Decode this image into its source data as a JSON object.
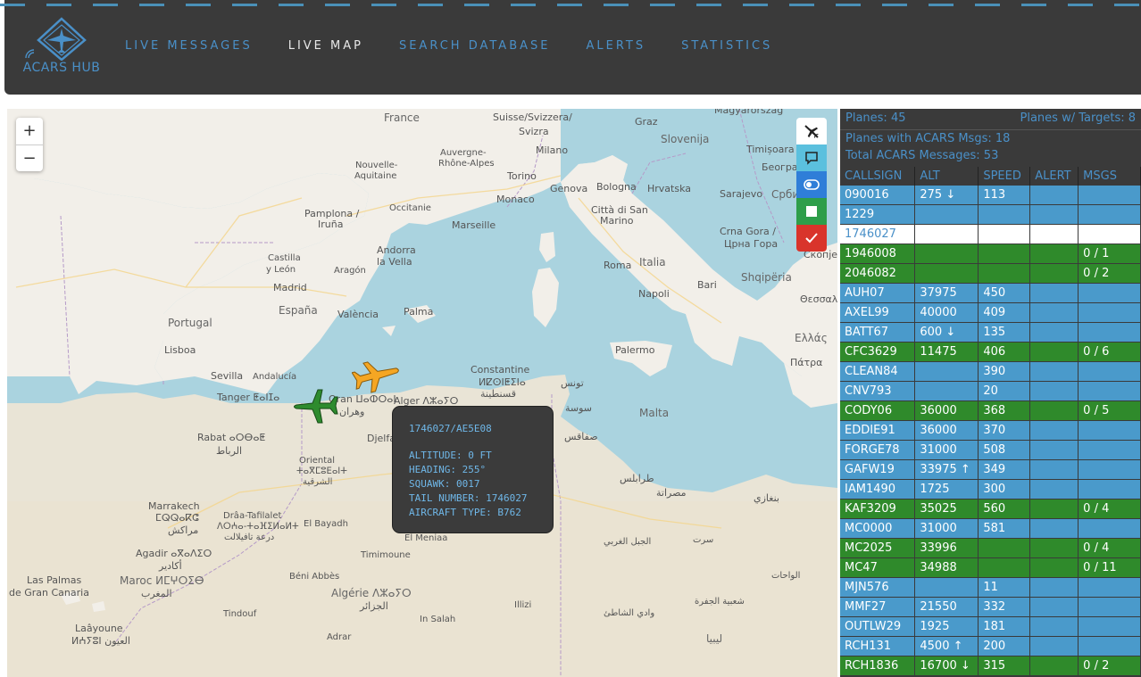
{
  "app": {
    "logo_text": "ACARS HUB",
    "nav": [
      {
        "label": "LIVE MESSAGES",
        "active": false
      },
      {
        "label": "LIVE MAP",
        "active": true
      },
      {
        "label": "SEARCH DATABASE",
        "active": false
      },
      {
        "label": "ALERTS",
        "active": false
      },
      {
        "label": "STATISTICS",
        "active": false
      }
    ]
  },
  "map": {
    "zoom_in": "+",
    "zoom_out": "−",
    "labels": {
      "france": "France",
      "suisse": "Suisse/Svizzera/",
      "svizra": "Svizra",
      "graz": "Graz",
      "magyarorszag": "Magyarország",
      "slovenija": "Slovenija",
      "timisoara": "Timișoara",
      "beograd": "Београд",
      "milano": "Milano",
      "auvergne": "Auvergne-",
      "rhone": "Rhône-Alpes",
      "torino": "Torino",
      "genova": "Genova",
      "bologna": "Bologna",
      "hrvatska": "Hrvatska",
      "sarajevo": "Sarajevo",
      "srbi": "Срби",
      "nouvelle": "Nouvelle-",
      "aquitaine": "Aquitaine",
      "occitanie": "Occitanie",
      "monaco": "Monaco",
      "citta1": "Città di San",
      "citta2": "Marino",
      "crnagora1": "Crna Gora /",
      "crnagora2": "Црна Гора",
      "skopje": "Скопје",
      "pamplona1": "Pamplona /",
      "pamplona2": "Iruña",
      "marseille": "Marseille",
      "andorra1": "Andorra",
      "andorra2": "la Vella",
      "roma": "Roma",
      "italia": "Italia",
      "bari": "Bari",
      "shqiperia": "Shqipëria",
      "castilla1": "Castilla",
      "castilla2": "y León",
      "aragon": "Aragón",
      "napoli": "Napoli",
      "thessaloniki": "Θεσσαλ",
      "madrid": "Madrid",
      "espana": "España",
      "valencia": "València",
      "palma": "Palma",
      "portugal": "Portugal",
      "ellas": "Ελλάς",
      "lisboa": "Lisboa",
      "patra": "Πάτρα",
      "palermo": "Palermo",
      "sevilla": "Sevilla",
      "andalucia": "Andalucía",
      "constantine1": "Constantine",
      "constantine2": "ⵍⵇⵙⵏⵟⵉⵏⴰ",
      "constantine3": "قسنطينة",
      "tunis": "تونس",
      "tanger": "Tanger ⵟⴰⵏⵊⴰ",
      "oran": "Oran ⵡⴰⵀⵔⴰⵏ",
      "wahran": "وهران",
      "alger": "Alger ⴷⵣⴰⵢⵔ",
      "sousse": "سوسة",
      "malta": "Malta",
      "rabat1": "Rabat ⴰⵔⴱⴰⵟ",
      "rabat2": "الرباط",
      "djelfa": "Djelfa",
      "sfax": "صفاقس",
      "oriental1": "Oriental",
      "oriental2": "ⵜⴰⴳⵎⵓⴹⴰⵏⵜ",
      "oriental3": "الشرقية",
      "tripoli": "طرابلس",
      "misrata": "مصراتة",
      "benghazi": "بنغازي",
      "marrakech1": "Marrakech",
      "marrakech2": "ⵎⵕⵕⴰⴽⵛ",
      "marrakech3": "مراكش",
      "draa1": "Drâa-Tafilalet",
      "draa2": "ⴷⵔⵄⴰ-ⵜⴰⴼⵉⵍⴰⵍⵜ",
      "draa3": "درعة تافيلالت",
      "elbayadh": "El Bayadh",
      "agadir1": "Agadir ⴰⴳⴰⴷⵉⵔ",
      "agadir2": "أكادير",
      "elmeniaa": "El Meniaa",
      "jabal": "الجبل الغربي",
      "sirte": "سرت",
      "lapalmas1": "Las Palmas",
      "lapalmas2": "de Gran Canaria",
      "maroc1": "Maroc ⵍⵎⵖⵔⵉⴱ",
      "maroc2": "المغرب",
      "timimoune": "Timimoune",
      "beniabbes": "Béni Abbès",
      "waha": "الواحات",
      "algerie1": "Algérie ⴷⵣⴰⵢⵔ",
      "algerie2": "الجزائر",
      "illizi": "Illizi",
      "shati": "وادي الشاطئ",
      "jufra": "شعبية الجفرة",
      "tindouf": "Tindouf",
      "insalah": "In Salah",
      "laayoune1": "Laâyoune",
      "laayoune2": "ⵍⵄⵢⵓⵏ العيون",
      "adrar": "Adrar",
      "libya": "ليبيا"
    },
    "tooltip": {
      "title": "1746027/AE5E08",
      "altitude": "ALTITUDE: 0 FT",
      "heading": "HEADING: 255°",
      "squawk": "SQUAWK: 0017",
      "tail": "TAIL NUMBER: 1746027",
      "type": "AIRCRAFT TYPE: B762"
    },
    "aircraft_colors": {
      "selected": "#f5a623",
      "acars": "#2e8b2e"
    }
  },
  "panel": {
    "planes": "Planes: 45",
    "planes_targets": "Planes w/ Targets: 8",
    "planes_acars": "Planes with ACARS Msgs: 18",
    "total_acars": "Total ACARS Messages: 53",
    "columns": [
      "CALLSIGN",
      "ALT",
      "SPEED",
      "ALERT",
      "MSGS"
    ],
    "rows": [
      {
        "c": "090016",
        "a": "275 ↓",
        "s": "113",
        "al": "",
        "m": "",
        "color": "blue"
      },
      {
        "c": "1229",
        "a": "",
        "s": "",
        "al": "",
        "m": "",
        "color": "blue"
      },
      {
        "c": "1746027",
        "a": "",
        "s": "",
        "al": "",
        "m": "",
        "color": "white"
      },
      {
        "c": "1946008",
        "a": "",
        "s": "",
        "al": "",
        "m": "0 / 1",
        "color": "green"
      },
      {
        "c": "2046082",
        "a": "",
        "s": "",
        "al": "",
        "m": "0 / 2",
        "color": "green"
      },
      {
        "c": "AUH07",
        "a": "37975",
        "s": "450",
        "al": "",
        "m": "",
        "color": "blue"
      },
      {
        "c": "AXEL99",
        "a": "40000",
        "s": "409",
        "al": "",
        "m": "",
        "color": "blue"
      },
      {
        "c": "BATT67",
        "a": "600 ↓",
        "s": "135",
        "al": "",
        "m": "",
        "color": "blue"
      },
      {
        "c": "CFC3629",
        "a": "11475",
        "s": "406",
        "al": "",
        "m": "0 / 6",
        "color": "green"
      },
      {
        "c": "CLEAN84",
        "a": "",
        "s": "390",
        "al": "",
        "m": "",
        "color": "blue"
      },
      {
        "c": "CNV793",
        "a": "",
        "s": "20",
        "al": "",
        "m": "",
        "color": "blue"
      },
      {
        "c": "CODY06",
        "a": "36000",
        "s": "368",
        "al": "",
        "m": "0 / 5",
        "color": "green"
      },
      {
        "c": "EDDIE91",
        "a": "36000",
        "s": "370",
        "al": "",
        "m": "",
        "color": "blue"
      },
      {
        "c": "FORGE78",
        "a": "31000",
        "s": "508",
        "al": "",
        "m": "",
        "color": "blue"
      },
      {
        "c": "GAFW19",
        "a": "33975 ↑",
        "s": "349",
        "al": "",
        "m": "",
        "color": "blue"
      },
      {
        "c": "IAM1490",
        "a": "1725",
        "s": "300",
        "al": "",
        "m": "",
        "color": "blue"
      },
      {
        "c": "KAF3209",
        "a": "35025",
        "s": "560",
        "al": "",
        "m": "0 / 4",
        "color": "green"
      },
      {
        "c": "MC0000",
        "a": "31000",
        "s": "581",
        "al": "",
        "m": "",
        "color": "blue"
      },
      {
        "c": "MC2025",
        "a": "33996",
        "s": "",
        "al": "",
        "m": "0 / 4",
        "color": "green"
      },
      {
        "c": "MC47",
        "a": "34988",
        "s": "",
        "al": "",
        "m": "0 / 11",
        "color": "green"
      },
      {
        "c": "MJN576",
        "a": "",
        "s": "11",
        "al": "",
        "m": "",
        "color": "blue"
      },
      {
        "c": "MMF27",
        "a": "21550",
        "s": "332",
        "al": "",
        "m": "",
        "color": "blue"
      },
      {
        "c": "OUTLW29",
        "a": "1925",
        "s": "181",
        "al": "",
        "m": "",
        "color": "blue"
      },
      {
        "c": "RCH131",
        "a": "4500 ↑",
        "s": "200",
        "al": "",
        "m": "",
        "color": "blue"
      },
      {
        "c": "RCH1836",
        "a": "16700 ↓",
        "s": "315",
        "al": "",
        "m": "0 / 2",
        "color": "green"
      }
    ]
  }
}
